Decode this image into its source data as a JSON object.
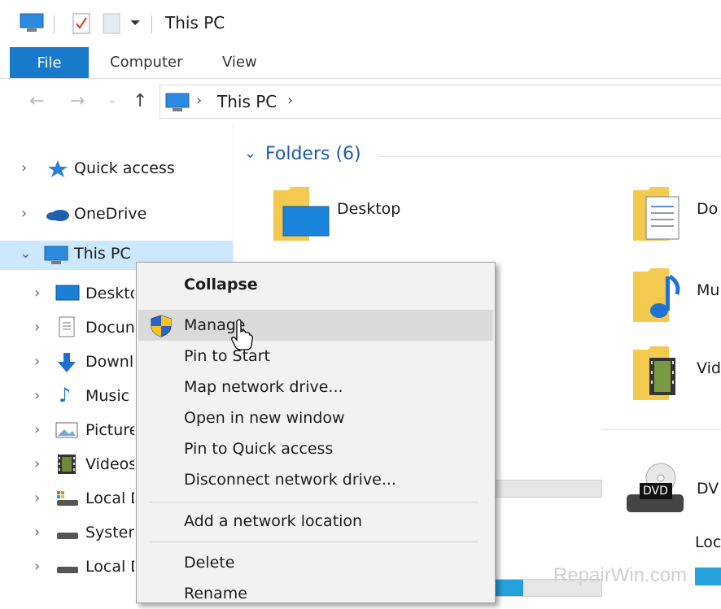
{
  "window": {
    "title": "This PC"
  },
  "ribbon": {
    "tabs": [
      "File",
      "Computer",
      "View"
    ]
  },
  "address": {
    "path": [
      "This PC"
    ]
  },
  "nav": {
    "items": [
      {
        "label": "Quick access",
        "icon": "star-icon",
        "expanded": false
      },
      {
        "label": "OneDrive",
        "icon": "cloud-icon",
        "expanded": false
      },
      {
        "label": "This PC",
        "icon": "computer-icon",
        "expanded": true,
        "selected": true
      },
      {
        "label": "Deskto",
        "icon": "desktop-icon"
      },
      {
        "label": "Docun",
        "icon": "document-icon"
      },
      {
        "label": "Downl",
        "icon": "download-icon"
      },
      {
        "label": "Music",
        "icon": "music-icon"
      },
      {
        "label": "Picture",
        "icon": "picture-icon"
      },
      {
        "label": "Videos",
        "icon": "video-icon"
      },
      {
        "label": "Local D",
        "icon": "local-disk-icon"
      },
      {
        "label": "System",
        "icon": "drive-icon"
      },
      {
        "label": "Local D",
        "icon": "drive-icon"
      }
    ]
  },
  "content": {
    "folders_header": "Folders (6)",
    "folders": [
      {
        "label": "Desktop"
      },
      {
        "label": "Do"
      },
      {
        "label": "Mu"
      },
      {
        "label": "Vid"
      }
    ],
    "devices": [
      {
        "label": "DV",
        "badge": "DVD"
      },
      {
        "label": "Loc"
      }
    ]
  },
  "context_menu": {
    "items": [
      {
        "label": "Collapse",
        "bold": true
      },
      {
        "label": "Manage",
        "icon": "uac-shield-icon",
        "hover": true
      },
      {
        "label": "Pin to Start"
      },
      {
        "label": "Map network drive..."
      },
      {
        "label": "Open in new window"
      },
      {
        "label": "Pin to Quick access"
      },
      {
        "label": "Disconnect network drive..."
      },
      {
        "label": "Add a network location"
      },
      {
        "label": "Delete"
      },
      {
        "label": "Rename"
      }
    ]
  },
  "watermark": "RepairWin.com",
  "colors": {
    "accent": "#1979ca",
    "selection": "#cce8ff",
    "menu_bg": "#f2f2f2",
    "menu_hover": "#dadada",
    "header_blue": "#1e5aa8"
  }
}
